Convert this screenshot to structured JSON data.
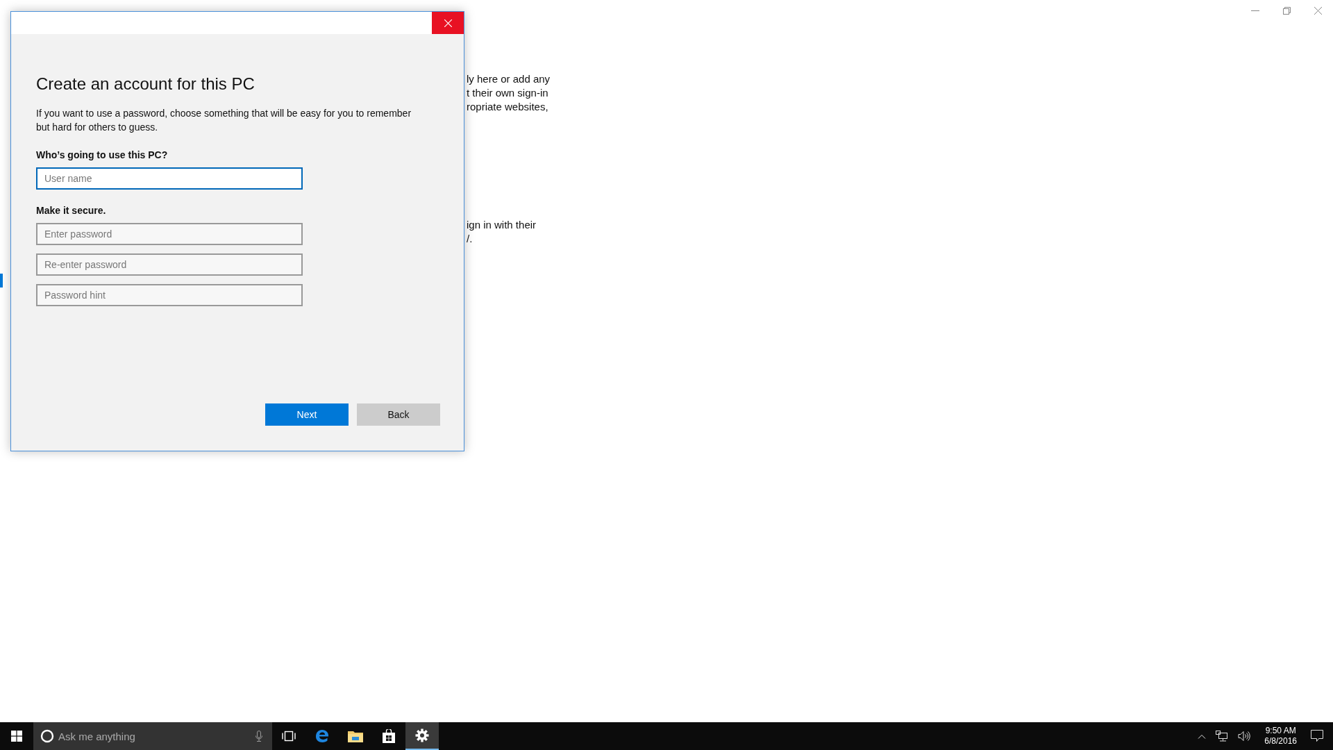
{
  "background_text": [
    "ly here or add any",
    "t their own sign-in",
    "ropriate websites,",
    "ign in with their",
    "/."
  ],
  "dialog": {
    "title": "Create an account for this PC",
    "description": "If you want to use a password, choose something that will be easy for you to remember but hard for others to guess.",
    "sections": [
      {
        "label": "Who’s going to use this PC?",
        "fields": [
          {
            "placeholder": "User name",
            "focused": true
          }
        ]
      },
      {
        "label": "Make it secure.",
        "fields": [
          {
            "placeholder": "Enter password",
            "focused": false
          },
          {
            "placeholder": "Re-enter password",
            "focused": false
          },
          {
            "placeholder": "Password hint",
            "focused": false
          }
        ]
      }
    ],
    "buttons": [
      {
        "label": "Next",
        "kind": "primary"
      },
      {
        "label": "Back",
        "kind": "secondary"
      }
    ]
  },
  "taskbar": {
    "search": {
      "placeholder": "Ask me anything"
    },
    "apps": [
      {
        "kind": "task-view",
        "selected": false
      },
      {
        "kind": "browser",
        "selected": false
      },
      {
        "kind": "folder",
        "selected": false
      },
      {
        "kind": "store",
        "selected": false
      },
      {
        "kind": "settings",
        "selected": true
      }
    ],
    "clock": {
      "time": "9:50 AM",
      "date": "6/8/2016"
    }
  }
}
